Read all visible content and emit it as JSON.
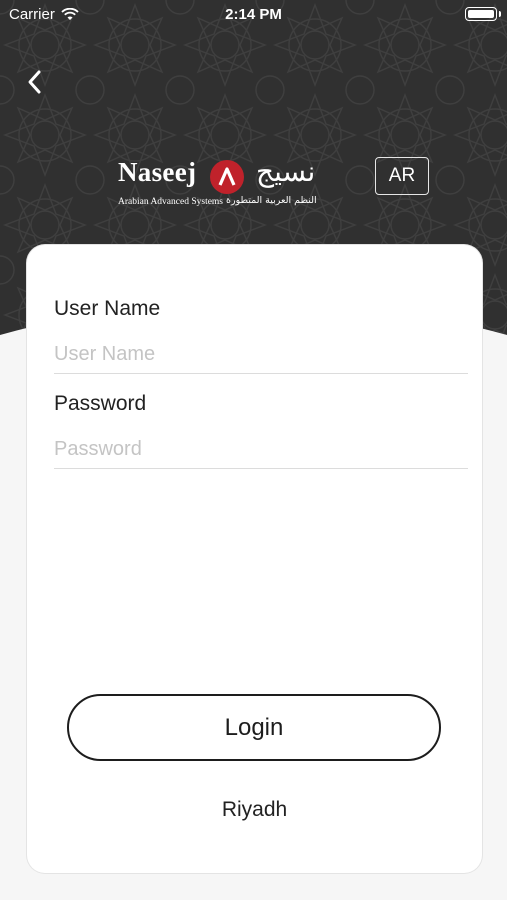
{
  "status_bar": {
    "carrier": "Carrier",
    "time": "2:14 PM",
    "battery_level": 1.0,
    "icons": [
      "wifi-icon",
      "battery-icon"
    ]
  },
  "header": {
    "back_icon": "chevron-left-icon",
    "logo": {
      "brand_en": "Naseej",
      "brand_ar": "نسيج",
      "tagline_en": "Arabian Advanced Systems",
      "tagline_ar": "النظم العربية المتطورة",
      "mark_symbol": "Λ",
      "mark_color": "#c0222b"
    },
    "language_button": "AR"
  },
  "form": {
    "username": {
      "label": "User Name",
      "placeholder": "User Name",
      "value": ""
    },
    "password": {
      "label": "Password",
      "placeholder": "Password",
      "value": ""
    },
    "login_button": "Login",
    "location": "Riyadh"
  },
  "colors": {
    "header_bg": "#2f2f2f",
    "page_bg": "#f6f6f6",
    "card_bg": "#ffffff",
    "accent": "#c0222b"
  }
}
